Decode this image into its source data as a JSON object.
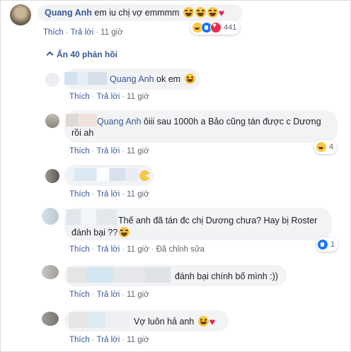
{
  "top_comment": {
    "author": "Quang Anh",
    "text": "em iu chị vợ emmmm",
    "actions": [
      "Thích",
      "Trả lời",
      "11 giờ"
    ],
    "reaction_count": "441"
  },
  "expand_replies": "Ẩn 40 phản hồi",
  "replies": [
    {
      "mention": "Quang Anh",
      "text": "ok em",
      "actions": [
        "Thích",
        "Trả lời",
        "11 giờ"
      ]
    },
    {
      "mention": "Quang Anh",
      "text_line1": "ôiii sau 1000h a Bảo cũng tán được c Dương",
      "text_line2": "rồi ah",
      "actions": [
        "Thích",
        "Trả lời",
        "11 giờ"
      ],
      "reaction_count": "4"
    },
    {
      "actions": [
        "Thích",
        "Trả lời",
        "11 giờ"
      ]
    },
    {
      "text_line1": "Thế anh đã tán đc chị Dương chưa? Hay bị Roster",
      "text_line2": "đánh bại ??",
      "actions": [
        "Thích",
        "Trả lời",
        "11 giờ",
        "Đã chỉnh sửa"
      ],
      "reaction_count": "1"
    },
    {
      "text": "đánh bại chính bố mình :))",
      "actions": [
        "Thích",
        "Trả lời",
        "11 giờ"
      ]
    },
    {
      "text": "Vợ luôn hả anh",
      "actions": [
        "Thích",
        "Trả lời",
        "11 giờ"
      ]
    }
  ],
  "colors": {
    "link": "#385898",
    "bubble": "#f2f3f5",
    "meta": "#606770"
  }
}
